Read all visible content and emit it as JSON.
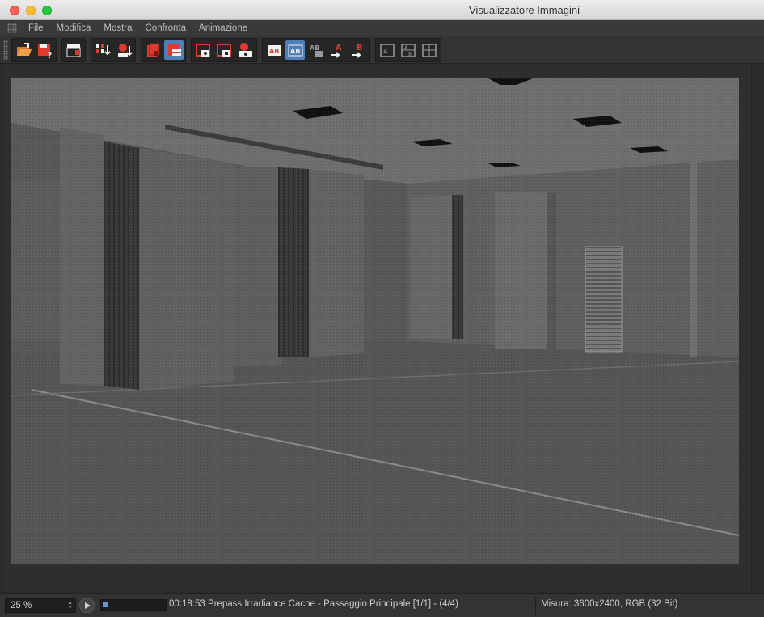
{
  "window": {
    "title": "Visualizzatore Immagini"
  },
  "menu": [
    "File",
    "Modifica",
    "Mostra",
    "Confronta",
    "Animazione"
  ],
  "toolbar": {
    "groups": [
      [
        {
          "icon": "open-folder-icon",
          "active": false
        },
        {
          "icon": "save-as-icon",
          "active": false
        }
      ],
      [
        {
          "icon": "clapperboard-icon",
          "active": false
        }
      ],
      [
        {
          "icon": "filter-down-icon",
          "active": false
        },
        {
          "icon": "user-down-icon",
          "active": false
        }
      ],
      [
        {
          "icon": "delete-red-icon",
          "active": false
        },
        {
          "icon": "clear-list-icon",
          "active": true
        }
      ],
      [
        {
          "icon": "frame-view-icon",
          "active": false
        },
        {
          "icon": "frame-stop-icon",
          "active": false
        },
        {
          "icon": "region-render-icon",
          "active": false
        }
      ],
      [
        {
          "icon": "ab-compare-icon",
          "active": false
        },
        {
          "icon": "ab-split-icon",
          "active": true
        },
        {
          "icon": "ab-swap-icon",
          "active": false
        },
        {
          "icon": "set-a-icon",
          "active": false
        },
        {
          "icon": "set-b-icon",
          "active": false
        }
      ],
      [
        {
          "icon": "layout-single-icon",
          "active": false
        },
        {
          "icon": "layout-double-icon",
          "active": false
        },
        {
          "icon": "layout-grid-icon",
          "active": false
        }
      ]
    ]
  },
  "status": {
    "zoom": "25 %",
    "progress": 0.08,
    "message": "00:18:53 Prepass Irradiance Cache - Passaggio Principale [1/1] - (4/4)",
    "info": "Misura: 3600x2400, RGB (32 Bit)"
  },
  "colors": {
    "accent": "#4d7fb8",
    "progress": "#5b9bd5",
    "red": "#e03a2e"
  }
}
